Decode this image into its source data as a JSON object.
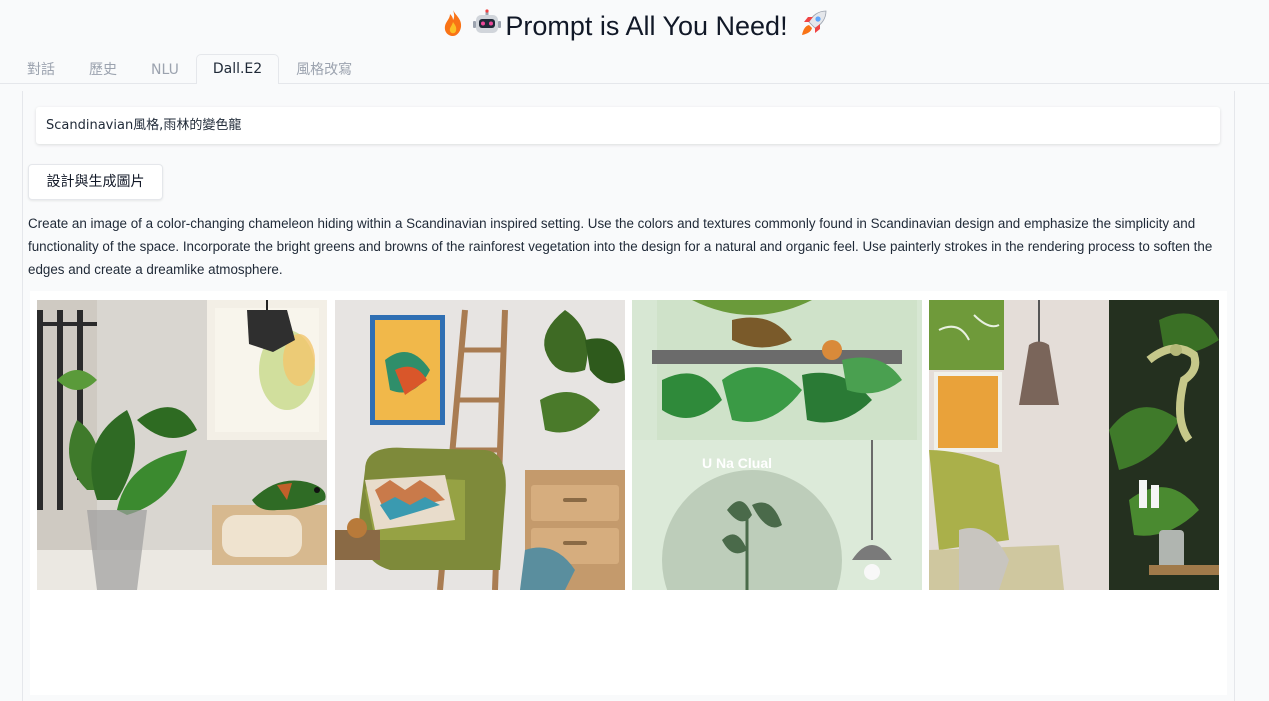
{
  "header": {
    "title": "Prompt is All You Need!",
    "left_icons": [
      "fire-icon",
      "robot-icon"
    ],
    "right_icon": "rocket-icon"
  },
  "tabs": [
    {
      "label": "對話",
      "active": false
    },
    {
      "label": "歷史",
      "active": false
    },
    {
      "label": "NLU",
      "active": false
    },
    {
      "label": "Dall.E2",
      "active": true
    },
    {
      "label": "風格改寫",
      "active": false
    }
  ],
  "dalle": {
    "prompt_value": "Scandinavian風格,雨林的變色龍",
    "generate_button": "設計與生成圖片",
    "description": "Create an image of a color-changing chameleon hiding within a Scandinavian inspired setting. Use the colors and textures commonly found in Scandinavian design and emphasize the simplicity and functionality of the space. Incorporate the bright greens and browns of the rainforest vegetation into the design for a natural and organic feel. Use painterly strokes in the rendering process to soften the edges and create a dreamlike atmosphere.",
    "images": [
      {
        "name": "generated-image-1"
      },
      {
        "name": "generated-image-2"
      },
      {
        "name": "generated-image-3",
        "overlay_text": "U Na Clual"
      },
      {
        "name": "generated-image-4"
      }
    ]
  },
  "colors": {
    "background": "#f9fafb",
    "active_tab_text": "#1f2937",
    "inactive_tab_text": "#9ca3af",
    "border": "#e5e7eb"
  }
}
